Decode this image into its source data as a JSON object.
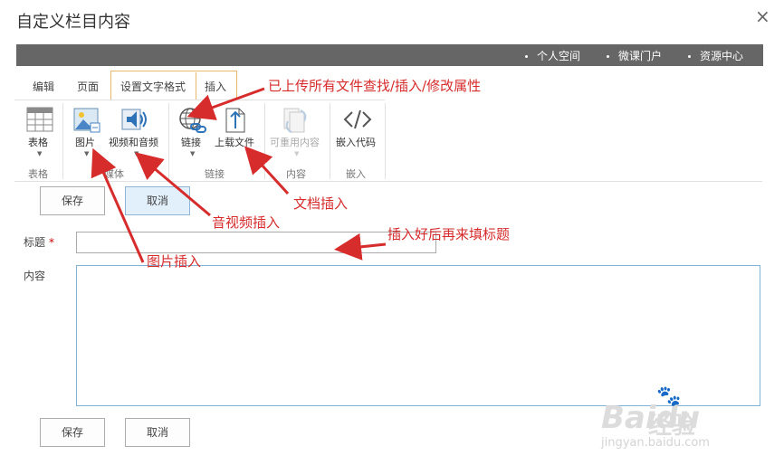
{
  "dialog": {
    "title": "自定义栏目内容",
    "close": "×"
  },
  "topbar": {
    "links": [
      "个人空间",
      "微课门户",
      "资源中心"
    ]
  },
  "tabs": [
    "编辑",
    "页面",
    "设置文字格式",
    "插入"
  ],
  "ribbon": {
    "buttons": {
      "table": "表格",
      "image": "图片",
      "video": "视频和音频",
      "link": "链接",
      "upload": "上载文件",
      "reusable": "可重用内容",
      "embed": "嵌入代码"
    },
    "groups": {
      "table": "表格",
      "media": "媒体",
      "link": "链接",
      "content": "内容",
      "embed": "嵌入"
    }
  },
  "form": {
    "save": "保存",
    "cancel": "取消",
    "title_label": "标题",
    "required_mark": "*",
    "content_label": "内容",
    "title_value": "",
    "content_value": ""
  },
  "annotations": {
    "uploaded": "已上传所有文件查找/插入/修改属性",
    "doc": "文档插入",
    "av": "音视频插入",
    "title_hint": "插入好后再来填标题",
    "image": "图片插入"
  },
  "watermark": {
    "brand": "Baidu",
    "brand_cn": "经验",
    "url": "jingyan.baidu.com"
  },
  "colors": {
    "topbar": "#666666",
    "tab_accent": "#e8b96c",
    "annotation": "#d62c2c",
    "content_border": "#7fb2d4"
  }
}
